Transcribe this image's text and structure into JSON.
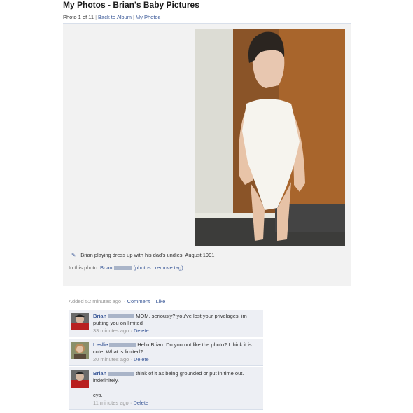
{
  "page": {
    "title": "My Photos - Brian's Baby Pictures"
  },
  "subnav": {
    "photo_count": "Photo 1 of 11",
    "back_link": "Back to Album",
    "my_photos_link": "My Photos"
  },
  "photo": {
    "caption": "Brian playing dress up with his dad's undies! August 1991",
    "tags_label": "In this photo: ",
    "tag_name": "Brian",
    "photos_link": "(photos",
    "separator": " | ",
    "remove_tag_link": "remove tag)"
  },
  "meta": {
    "added": "Added 52 minutes ago",
    "comment_link": "Comment",
    "like_link": "Like"
  },
  "comments": [
    {
      "author": "Brian",
      "text": "MOM, seriously? you've lost your privelages, im putting you on limited",
      "time": "33 minutes ago",
      "delete_label": "Delete"
    },
    {
      "author": "Leslie",
      "text": "Hello Brian. Do you not like the photo? I think it is cute. What is limited?",
      "time": "20 minutes ago",
      "delete_label": "Delete"
    },
    {
      "author": "Brian",
      "text": "think of it as being grounded or put in time out. indefinitely.",
      "text2": "cya.",
      "time": "11 minutes ago",
      "delete_label": "Delete"
    }
  ],
  "colors": {
    "link": "#3b5998",
    "comment_bg": "#edeff4",
    "viewer_bg": "#f2f2f2",
    "redaction": "#a9b4c8"
  }
}
